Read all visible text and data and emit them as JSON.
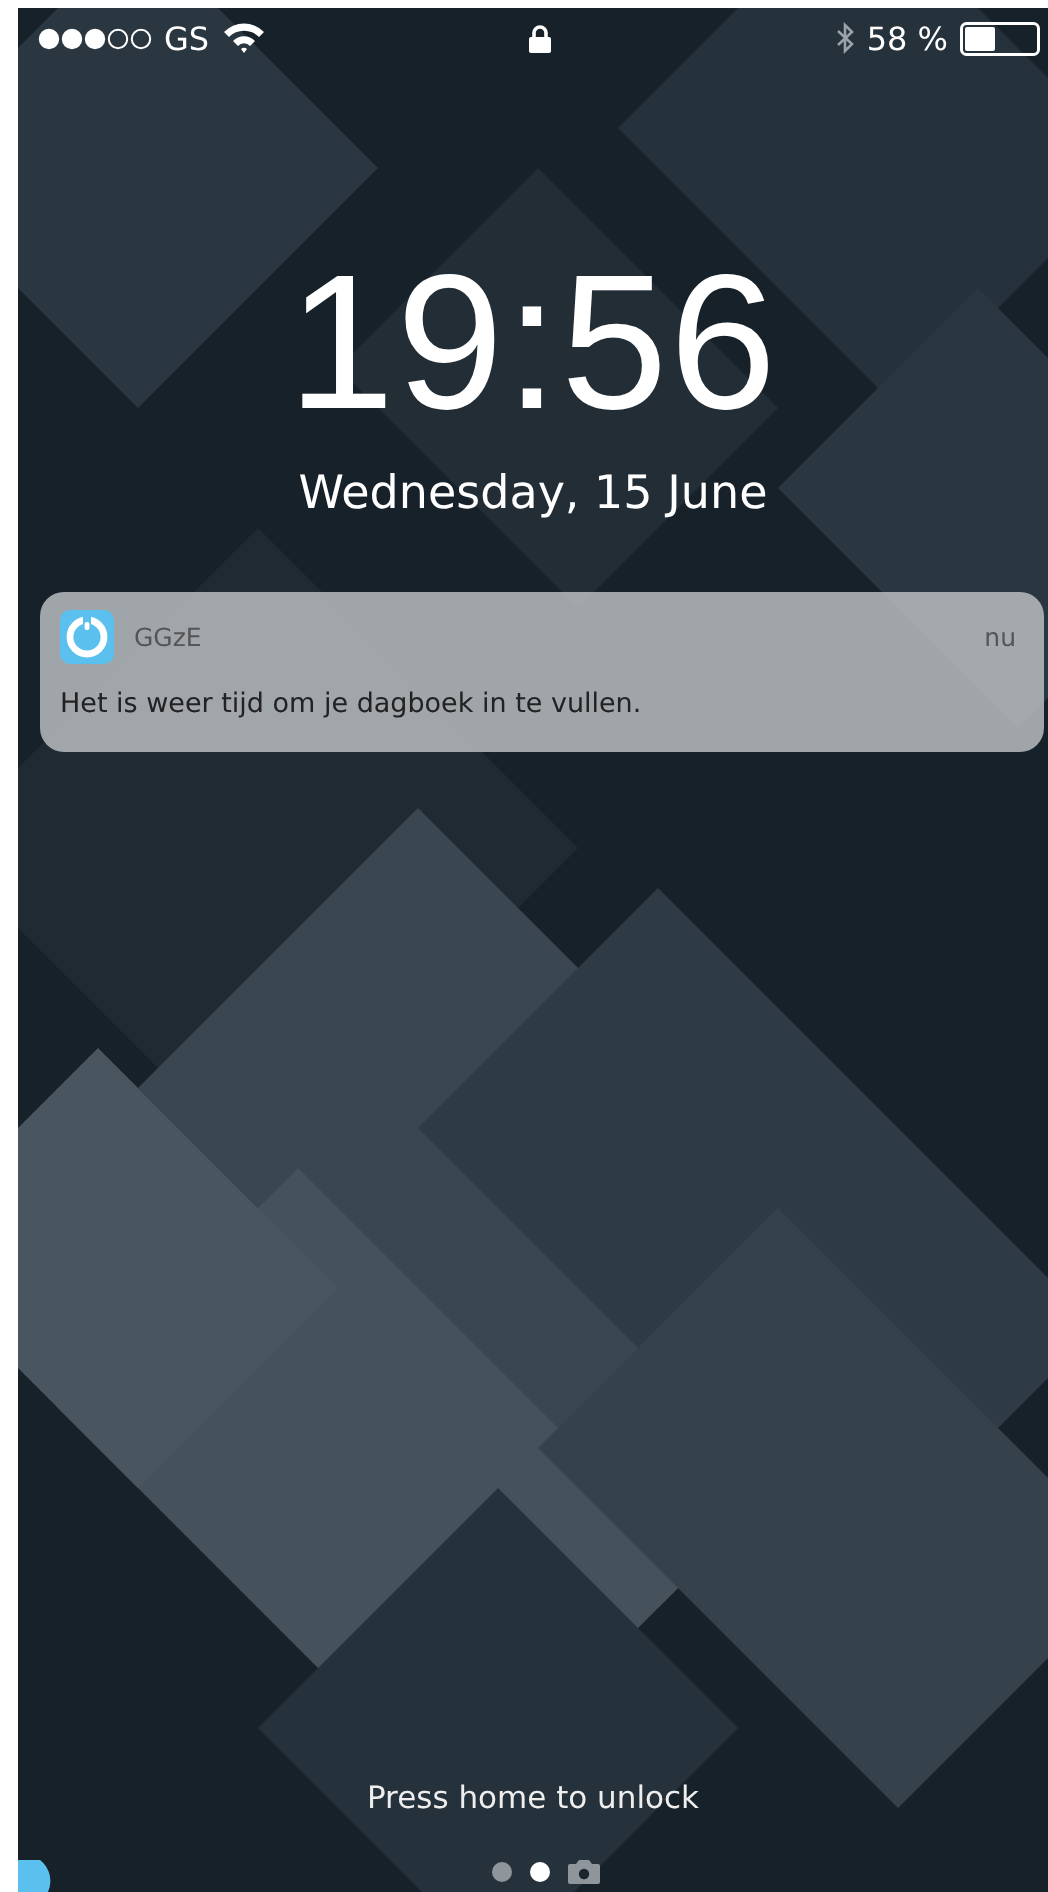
{
  "status_bar": {
    "carrier": "GS",
    "battery_text": "58 %"
  },
  "lock_screen": {
    "time": "19:56",
    "date": "Wednesday, 15 June"
  },
  "notifications": [
    {
      "app": "GGzE",
      "time": "nu",
      "message": "Het is weer tijd om je dagboek in te vullen."
    }
  ],
  "unlock_hint": "Press home to unlock",
  "page_indicators": [
    {
      "kind": "dot",
      "selected": false
    },
    {
      "kind": "dot",
      "selected": true
    },
    {
      "kind": "camera",
      "selected": false
    }
  ]
}
